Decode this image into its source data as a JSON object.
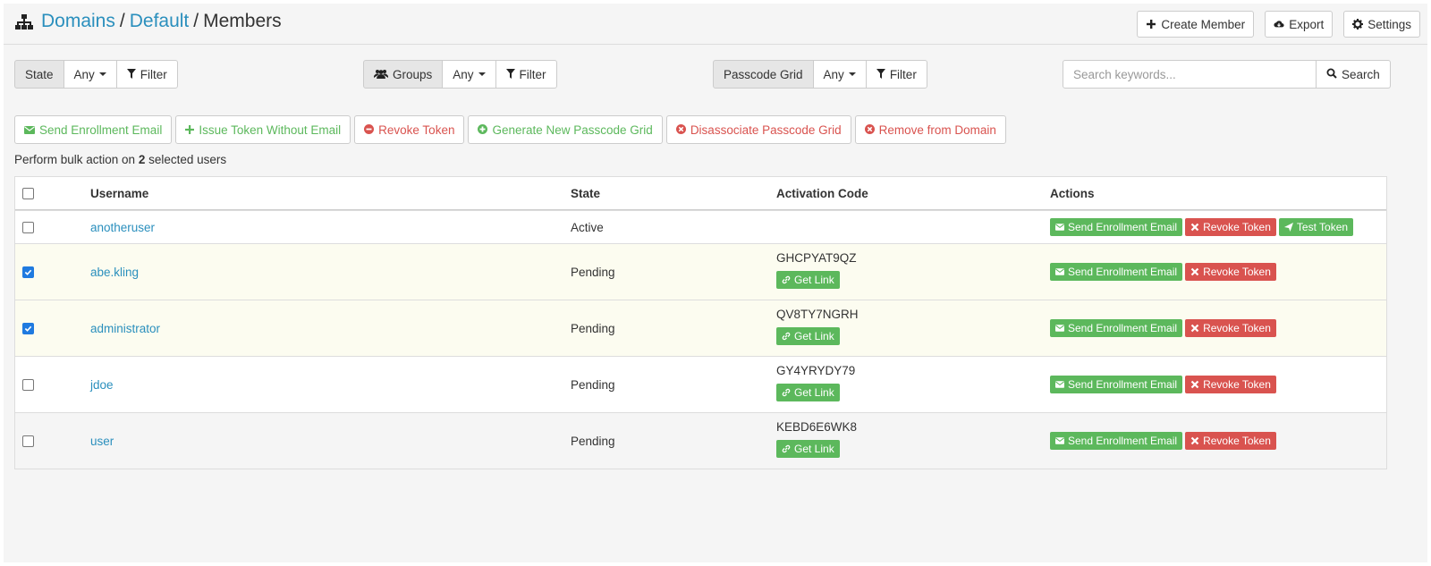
{
  "breadcrumb": {
    "domains": "Domains",
    "default": "Default",
    "current": "Members",
    "sep": "/"
  },
  "header_buttons": {
    "create": "Create Member",
    "export": "Export",
    "settings": "Settings"
  },
  "filters": {
    "state": {
      "label": "State",
      "value": "Any",
      "filter": "Filter"
    },
    "groups": {
      "label": "Groups",
      "value": "Any",
      "filter": "Filter"
    },
    "passcode": {
      "label": "Passcode Grid",
      "value": "Any",
      "filter": "Filter"
    }
  },
  "search": {
    "placeholder": "Search keywords...",
    "button": "Search"
  },
  "bulk": {
    "send": "Send Enrollment Email",
    "issue": "Issue Token Without Email",
    "revoke": "Revoke Token",
    "generate": "Generate New Passcode Grid",
    "disassociate": "Disassociate Passcode Grid",
    "remove": "Remove from Domain",
    "note_pre": "Perform bulk action on ",
    "note_count": "2",
    "note_post": " selected users"
  },
  "table": {
    "headers": {
      "username": "Username",
      "state": "State",
      "code": "Activation Code",
      "actions": "Actions"
    },
    "rows": [
      {
        "username": "anotheruser",
        "state": "Active",
        "code": "",
        "checked": false
      },
      {
        "username": "abe.kling",
        "state": "Pending",
        "code": "GHCPYAT9QZ",
        "checked": true
      },
      {
        "username": "administrator",
        "state": "Pending",
        "code": "QV8TY7NGRH",
        "checked": true
      },
      {
        "username": "jdoe",
        "state": "Pending",
        "code": "GY4YRYDY79",
        "checked": false
      },
      {
        "username": "user",
        "state": "Pending",
        "code": "KEBD6E6WK8",
        "checked": false
      }
    ],
    "actions": {
      "send": "Send Enrollment Email",
      "revoke": "Revoke Token",
      "test": "Test Token",
      "link": "Get Link"
    }
  },
  "colors": {
    "link": "#2a8fbd",
    "success": "#5cb85c",
    "danger": "#d9534f",
    "checkbox": "#1f7ae0"
  }
}
